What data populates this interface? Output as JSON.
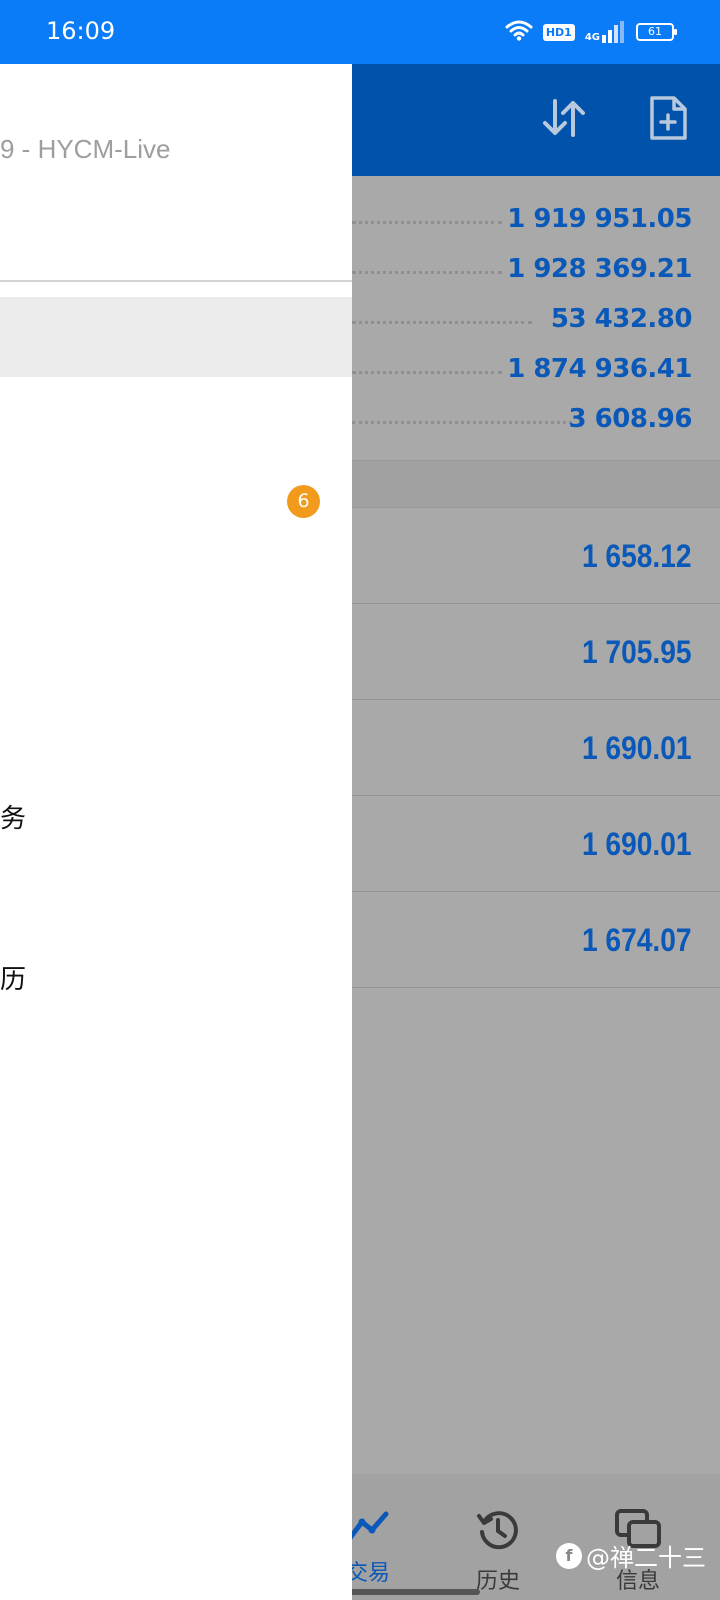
{
  "status_bar": {
    "time": "16:09",
    "network_badge": "HD1",
    "signal_label": "4G",
    "battery": "61",
    "icons": [
      "wifi-icon",
      "hd-icon",
      "signal-icon",
      "battery-icon"
    ]
  },
  "toolbar": {
    "icons": [
      "sort-icon",
      "new-order-icon"
    ]
  },
  "summary": {
    "values": [
      "1 919 951.05",
      "1 928 369.21",
      "53 432.80",
      "1 874 936.41",
      "3 608.96"
    ]
  },
  "positions": {
    "values": [
      "1 658.12",
      "1 705.95",
      "1 690.01",
      "1 690.01",
      "1 674.07"
    ]
  },
  "bottom_nav": {
    "trade_label": "交易",
    "history_label": "历史",
    "messages_label": "信息"
  },
  "drawer": {
    "account_text": "9 - HYCM-Live",
    "badge_count": "6",
    "menu_text_1": "务",
    "menu_text_2": "历"
  },
  "watermark": {
    "text": "@禅二十三"
  },
  "colors": {
    "status_bar": "#0a7cf7",
    "app_bar": "#0052ab",
    "value_text": "#0a58b8",
    "badge": "#f29a1c",
    "scrim": "#a9a9a9"
  }
}
